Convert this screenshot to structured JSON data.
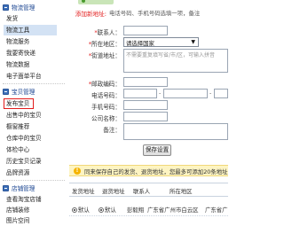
{
  "sidebar": {
    "group1": {
      "title": "物流管理"
    },
    "group1_items": [
      "发货",
      "物流工具",
      "物流服务",
      "我要寄快递",
      "物流数据",
      "电子面单平台"
    ],
    "group2": {
      "title": "宝贝管理"
    },
    "group2_items": [
      "发布宝贝",
      "出售中的宝贝",
      "橱窗推荐",
      "仓库中的宝贝",
      "体检中心",
      "历史宝贝记录",
      "品牌资源"
    ],
    "group3": {
      "title": "店铺管理"
    },
    "group3_items": [
      "查看淘宝店铺",
      "店铺装修",
      "图片空间"
    ]
  },
  "form": {
    "address_label": "添加新地址:",
    "address_hint": "电话号码、手机号码选填一项，备注",
    "contact_label": "联系人：",
    "region_label": "所在地区：",
    "region_value": "请选择国家",
    "street_label": "街道地址：",
    "street_placeholder": "不需要重复填写省/市/区，可输入拼音",
    "zip_label": "邮政编码：",
    "phone_label": "电话号码：",
    "mobile_label": "手机号码：",
    "company_label": "公司名称：",
    "remark_label": "备注：",
    "save_label": "保存设置"
  },
  "notice": {
    "icon": "!",
    "text": "同来保存自己的发货、退货地址，您最多可添加20条地址"
  },
  "table": {
    "headers": [
      "发货地址",
      "退货地址",
      "联系人",
      "所在地区"
    ],
    "row": {
      "send_label": "默认",
      "return_label": "默认",
      "contact": "彭毅翔",
      "region": "广东省广州市白云区",
      "address": "广东省广"
    }
  }
}
